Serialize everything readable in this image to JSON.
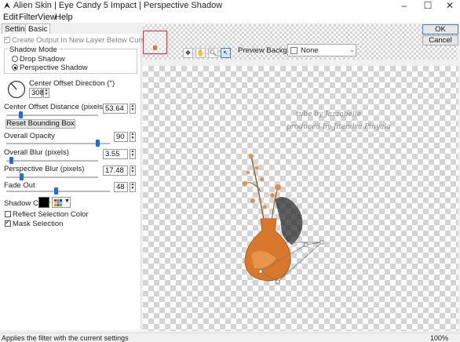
{
  "window": {
    "title": "Alien Skin | Eye Candy 5 Impact | Perspective Shadow"
  },
  "menu": [
    "Edit",
    "Filter",
    "View",
    "Help"
  ],
  "tabs": [
    {
      "label": "Settings",
      "active": false
    },
    {
      "label": "Basic",
      "active": true
    }
  ],
  "basic": {
    "create_output_label": "Create Output In New Layer Below Current",
    "create_output_checked": true,
    "shadow_mode": {
      "title": "Shadow Mode",
      "options": [
        {
          "label": "Drop Shadow",
          "selected": false
        },
        {
          "label": "Perspective Shadow",
          "selected": true
        }
      ]
    },
    "center_offset_direction": {
      "label": "Center Offset Direction (°)",
      "value": "308"
    },
    "center_offset_distance": {
      "label": "Center Offset Distance (pixels)",
      "value": "53.64",
      "level": 0.11
    },
    "reset_bounding_box_label": "Reset Bounding Box",
    "overall_opacity": {
      "label": "Overall Opacity",
      "value": "90",
      "level": 0.9
    },
    "overall_blur": {
      "label": "Overall Blur (pixels)",
      "value": "3.55",
      "level": 0.04
    },
    "perspective_blur": {
      "label": "Perspective Blur (pixels)",
      "value": "17.48",
      "level": 0.17
    },
    "fade_out": {
      "label": "Fade Out",
      "value": "48",
      "level": 0.48
    },
    "shadow_color": {
      "label": "Shadow Color",
      "value": "#000000"
    },
    "reflect_selection_color": {
      "label": "Reflect Selection Color",
      "checked": false
    },
    "mask_selection": {
      "label": "Mask Selection",
      "checked": true
    }
  },
  "preview": {
    "background_label": "Preview Background:",
    "background_value": "None",
    "watermark_lines": [
      "tube by Jazzabelle",
      "produced by Jitendra Pinyala"
    ]
  },
  "buttons": {
    "ok": "OK",
    "cancel": "Cancel"
  },
  "status": {
    "message": "Applies the filter with the current settings",
    "zoom": "100%"
  },
  "colors": {
    "accent": "#1f6fd8",
    "vase": "#d8782c"
  },
  "icons": [
    "app-logo-icon",
    "minimize-icon",
    "maximize-icon",
    "close-icon",
    "move-tool-icon",
    "hand-tool-icon",
    "zoom-tool-icon",
    "pointer-tool-icon",
    "palette-icon",
    "chevron-down-icon"
  ]
}
